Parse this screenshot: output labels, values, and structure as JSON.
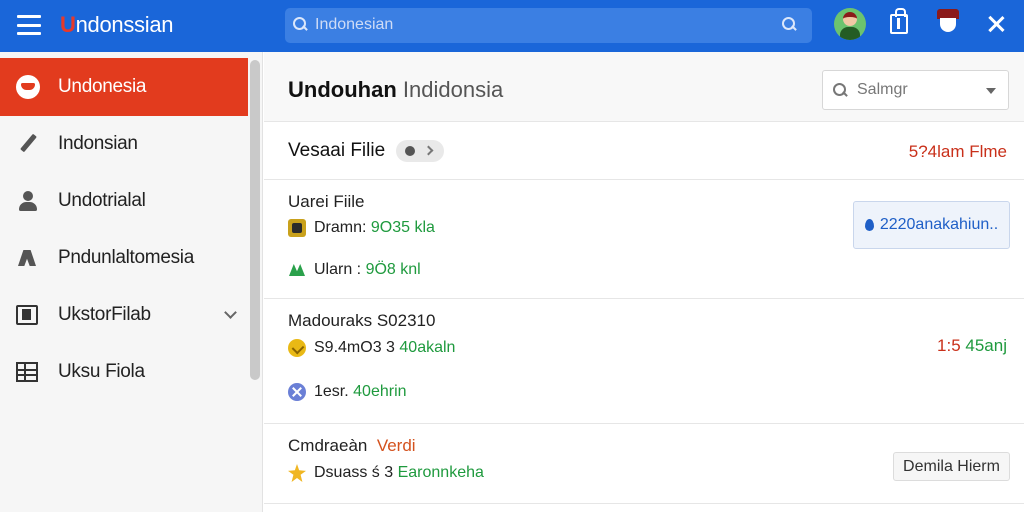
{
  "app": {
    "brand_prefix": "U",
    "brand_rest": "ndonssian",
    "search_placeholder": "Indonesian"
  },
  "sidebar": {
    "items": [
      {
        "label": "Undonesia",
        "icon": "badge-icon",
        "active": true
      },
      {
        "label": "Indonsian",
        "icon": "pen-icon"
      },
      {
        "label": "Undotrialal",
        "icon": "user-icon"
      },
      {
        "label": "Pndunlaltomesia",
        "icon": "tools-icon"
      },
      {
        "label": "UkstorFilab",
        "icon": "book-icon",
        "expandable": true
      },
      {
        "label": "Uksu Fiola",
        "icon": "grid-icon"
      }
    ]
  },
  "main": {
    "title_bold": "Undouhan",
    "title_sub": "Indidonsia",
    "dropdown_value": "Salmgr",
    "header_row": {
      "title": "Vesaai Filie",
      "right_text": "5?4lam Flme"
    },
    "cards": [
      {
        "title": "Uarei Fiile",
        "lines": [
          {
            "icon": "bag-icon",
            "text": "Dramn:",
            "value": "9O35 kla"
          },
          {
            "icon": "leaf-icon",
            "text": "Ularn :",
            "value": "9Ö8 knl"
          }
        ],
        "button": "2220anakahiun.."
      },
      {
        "title": "Madouraks S02310",
        "lines": [
          {
            "icon": "coin-icon",
            "text": "S9.4mO3 3",
            "value": "40akaln"
          },
          {
            "icon": "cross-icon",
            "text": "1esr.",
            "value": "40ehrin"
          }
        ],
        "amount_a": "1:5",
        "amount_b": "45anj"
      },
      {
        "title": "Cmdraeàn",
        "title_tag": "Verdi",
        "lines": [
          {
            "icon": "star-icon",
            "text": "Dsuass ś 3",
            "value": "Earonnkeha"
          }
        ],
        "button": "Demila Hierm"
      }
    ]
  },
  "colors": {
    "topbar": "#1a66d9",
    "active": "#e23b1e",
    "accent_red": "#c9301a",
    "accent_green": "#1f9a3e",
    "accent_blue": "#1f5fc7"
  }
}
